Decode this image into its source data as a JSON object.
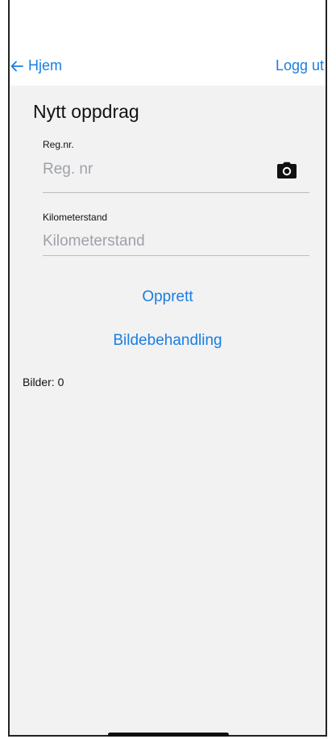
{
  "nav": {
    "back_label": "Hjem",
    "logout_label": "Logg ut"
  },
  "page": {
    "title": "Nytt oppdrag"
  },
  "form": {
    "reg_label": "Reg.nr.",
    "reg_placeholder": "Reg. nr",
    "reg_value": "",
    "km_label": "Kilometerstand",
    "km_placeholder": "Kilometerstand",
    "km_value": ""
  },
  "actions": {
    "create_label": "Opprett",
    "image_processing_label": "Bildebehandling"
  },
  "images": {
    "count_text": "Bilder: 0"
  },
  "icons": {
    "back": "arrow-left-icon",
    "camera": "camera-icon"
  },
  "colors": {
    "accent": "#1a7ee0",
    "background": "#f2f2f3"
  }
}
